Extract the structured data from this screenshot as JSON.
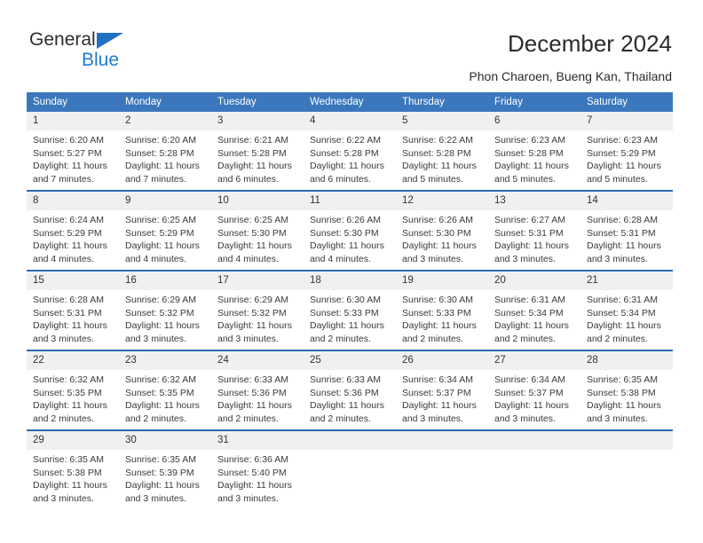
{
  "branding": {
    "logo_text_primary": "General",
    "logo_text_secondary": "Blue",
    "logo_triangle_color": "#1f6fc4",
    "logo_blue_color": "#1f7ad4"
  },
  "header": {
    "title": "December 2024",
    "subtitle": "Phon Charoen, Bueng Kan, Thailand"
  },
  "theme": {
    "header_row_background": "#3b77bd",
    "header_row_text": "#ffffff",
    "week_separator": "#2a6cb0",
    "daynum_background": "#f0f0f0",
    "page_background": "#ffffff"
  },
  "weekday_headers": [
    "Sunday",
    "Monday",
    "Tuesday",
    "Wednesday",
    "Thursday",
    "Friday",
    "Saturday"
  ],
  "labels": {
    "sunrise_prefix": "Sunrise:",
    "sunset_prefix": "Sunset:",
    "daylight_prefix": "Daylight:"
  },
  "weeks": [
    [
      {
        "day": "1",
        "sunrise": "Sunrise: 6:20 AM",
        "sunset": "Sunset: 5:27 PM",
        "daylight_line1": "Daylight: 11 hours",
        "daylight_line2": "and 7 minutes."
      },
      {
        "day": "2",
        "sunrise": "Sunrise: 6:20 AM",
        "sunset": "Sunset: 5:28 PM",
        "daylight_line1": "Daylight: 11 hours",
        "daylight_line2": "and 7 minutes."
      },
      {
        "day": "3",
        "sunrise": "Sunrise: 6:21 AM",
        "sunset": "Sunset: 5:28 PM",
        "daylight_line1": "Daylight: 11 hours",
        "daylight_line2": "and 6 minutes."
      },
      {
        "day": "4",
        "sunrise": "Sunrise: 6:22 AM",
        "sunset": "Sunset: 5:28 PM",
        "daylight_line1": "Daylight: 11 hours",
        "daylight_line2": "and 6 minutes."
      },
      {
        "day": "5",
        "sunrise": "Sunrise: 6:22 AM",
        "sunset": "Sunset: 5:28 PM",
        "daylight_line1": "Daylight: 11 hours",
        "daylight_line2": "and 5 minutes."
      },
      {
        "day": "6",
        "sunrise": "Sunrise: 6:23 AM",
        "sunset": "Sunset: 5:28 PM",
        "daylight_line1": "Daylight: 11 hours",
        "daylight_line2": "and 5 minutes."
      },
      {
        "day": "7",
        "sunrise": "Sunrise: 6:23 AM",
        "sunset": "Sunset: 5:29 PM",
        "daylight_line1": "Daylight: 11 hours",
        "daylight_line2": "and 5 minutes."
      }
    ],
    [
      {
        "day": "8",
        "sunrise": "Sunrise: 6:24 AM",
        "sunset": "Sunset: 5:29 PM",
        "daylight_line1": "Daylight: 11 hours",
        "daylight_line2": "and 4 minutes."
      },
      {
        "day": "9",
        "sunrise": "Sunrise: 6:25 AM",
        "sunset": "Sunset: 5:29 PM",
        "daylight_line1": "Daylight: 11 hours",
        "daylight_line2": "and 4 minutes."
      },
      {
        "day": "10",
        "sunrise": "Sunrise: 6:25 AM",
        "sunset": "Sunset: 5:30 PM",
        "daylight_line1": "Daylight: 11 hours",
        "daylight_line2": "and 4 minutes."
      },
      {
        "day": "11",
        "sunrise": "Sunrise: 6:26 AM",
        "sunset": "Sunset: 5:30 PM",
        "daylight_line1": "Daylight: 11 hours",
        "daylight_line2": "and 4 minutes."
      },
      {
        "day": "12",
        "sunrise": "Sunrise: 6:26 AM",
        "sunset": "Sunset: 5:30 PM",
        "daylight_line1": "Daylight: 11 hours",
        "daylight_line2": "and 3 minutes."
      },
      {
        "day": "13",
        "sunrise": "Sunrise: 6:27 AM",
        "sunset": "Sunset: 5:31 PM",
        "daylight_line1": "Daylight: 11 hours",
        "daylight_line2": "and 3 minutes."
      },
      {
        "day": "14",
        "sunrise": "Sunrise: 6:28 AM",
        "sunset": "Sunset: 5:31 PM",
        "daylight_line1": "Daylight: 11 hours",
        "daylight_line2": "and 3 minutes."
      }
    ],
    [
      {
        "day": "15",
        "sunrise": "Sunrise: 6:28 AM",
        "sunset": "Sunset: 5:31 PM",
        "daylight_line1": "Daylight: 11 hours",
        "daylight_line2": "and 3 minutes."
      },
      {
        "day": "16",
        "sunrise": "Sunrise: 6:29 AM",
        "sunset": "Sunset: 5:32 PM",
        "daylight_line1": "Daylight: 11 hours",
        "daylight_line2": "and 3 minutes."
      },
      {
        "day": "17",
        "sunrise": "Sunrise: 6:29 AM",
        "sunset": "Sunset: 5:32 PM",
        "daylight_line1": "Daylight: 11 hours",
        "daylight_line2": "and 3 minutes."
      },
      {
        "day": "18",
        "sunrise": "Sunrise: 6:30 AM",
        "sunset": "Sunset: 5:33 PM",
        "daylight_line1": "Daylight: 11 hours",
        "daylight_line2": "and 2 minutes."
      },
      {
        "day": "19",
        "sunrise": "Sunrise: 6:30 AM",
        "sunset": "Sunset: 5:33 PM",
        "daylight_line1": "Daylight: 11 hours",
        "daylight_line2": "and 2 minutes."
      },
      {
        "day": "20",
        "sunrise": "Sunrise: 6:31 AM",
        "sunset": "Sunset: 5:34 PM",
        "daylight_line1": "Daylight: 11 hours",
        "daylight_line2": "and 2 minutes."
      },
      {
        "day": "21",
        "sunrise": "Sunrise: 6:31 AM",
        "sunset": "Sunset: 5:34 PM",
        "daylight_line1": "Daylight: 11 hours",
        "daylight_line2": "and 2 minutes."
      }
    ],
    [
      {
        "day": "22",
        "sunrise": "Sunrise: 6:32 AM",
        "sunset": "Sunset: 5:35 PM",
        "daylight_line1": "Daylight: 11 hours",
        "daylight_line2": "and 2 minutes."
      },
      {
        "day": "23",
        "sunrise": "Sunrise: 6:32 AM",
        "sunset": "Sunset: 5:35 PM",
        "daylight_line1": "Daylight: 11 hours",
        "daylight_line2": "and 2 minutes."
      },
      {
        "day": "24",
        "sunrise": "Sunrise: 6:33 AM",
        "sunset": "Sunset: 5:36 PM",
        "daylight_line1": "Daylight: 11 hours",
        "daylight_line2": "and 2 minutes."
      },
      {
        "day": "25",
        "sunrise": "Sunrise: 6:33 AM",
        "sunset": "Sunset: 5:36 PM",
        "daylight_line1": "Daylight: 11 hours",
        "daylight_line2": "and 2 minutes."
      },
      {
        "day": "26",
        "sunrise": "Sunrise: 6:34 AM",
        "sunset": "Sunset: 5:37 PM",
        "daylight_line1": "Daylight: 11 hours",
        "daylight_line2": "and 3 minutes."
      },
      {
        "day": "27",
        "sunrise": "Sunrise: 6:34 AM",
        "sunset": "Sunset: 5:37 PM",
        "daylight_line1": "Daylight: 11 hours",
        "daylight_line2": "and 3 minutes."
      },
      {
        "day": "28",
        "sunrise": "Sunrise: 6:35 AM",
        "sunset": "Sunset: 5:38 PM",
        "daylight_line1": "Daylight: 11 hours",
        "daylight_line2": "and 3 minutes."
      }
    ],
    [
      {
        "day": "29",
        "sunrise": "Sunrise: 6:35 AM",
        "sunset": "Sunset: 5:38 PM",
        "daylight_line1": "Daylight: 11 hours",
        "daylight_line2": "and 3 minutes."
      },
      {
        "day": "30",
        "sunrise": "Sunrise: 6:35 AM",
        "sunset": "Sunset: 5:39 PM",
        "daylight_line1": "Daylight: 11 hours",
        "daylight_line2": "and 3 minutes."
      },
      {
        "day": "31",
        "sunrise": "Sunrise: 6:36 AM",
        "sunset": "Sunset: 5:40 PM",
        "daylight_line1": "Daylight: 11 hours",
        "daylight_line2": "and 3 minutes."
      },
      {
        "day": "",
        "sunrise": "",
        "sunset": "",
        "daylight_line1": "",
        "daylight_line2": ""
      },
      {
        "day": "",
        "sunrise": "",
        "sunset": "",
        "daylight_line1": "",
        "daylight_line2": ""
      },
      {
        "day": "",
        "sunrise": "",
        "sunset": "",
        "daylight_line1": "",
        "daylight_line2": ""
      },
      {
        "day": "",
        "sunrise": "",
        "sunset": "",
        "daylight_line1": "",
        "daylight_line2": ""
      }
    ]
  ]
}
